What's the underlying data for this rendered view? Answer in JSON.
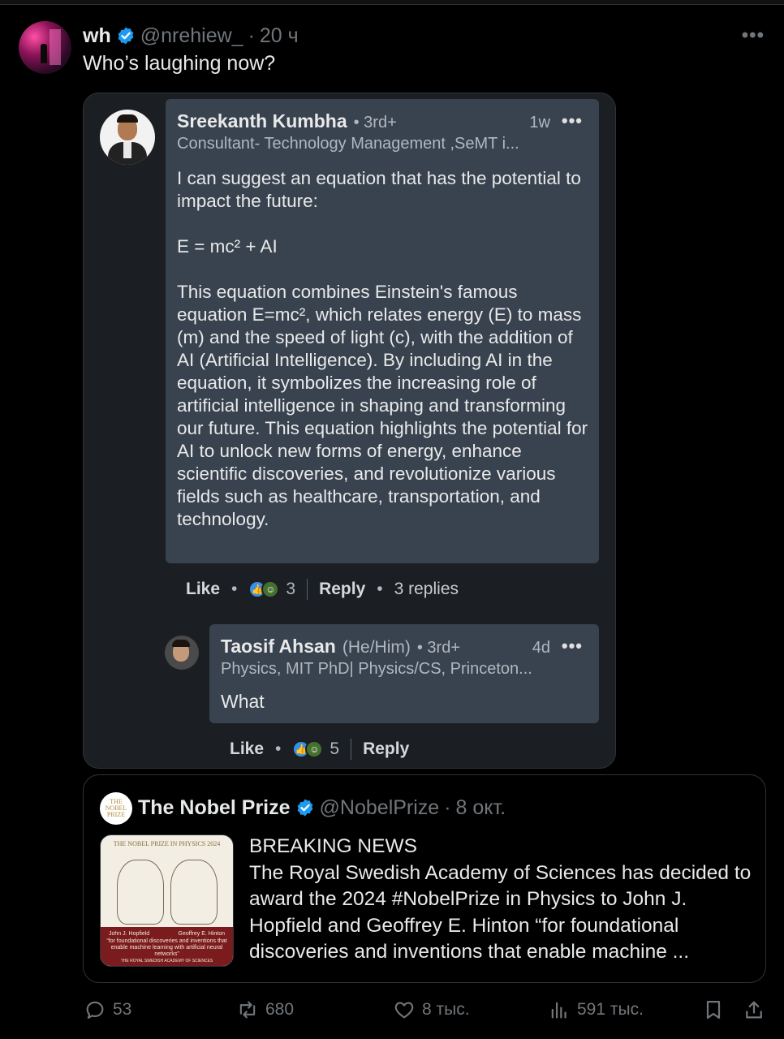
{
  "tweet": {
    "name": "wh",
    "handle": "@nrehiew_",
    "separator": "·",
    "time": "20 ч",
    "text": "Who’s laughing now?",
    "more": "•••"
  },
  "screenshot": {
    "comment1": {
      "name": "Sreekanth Kumbha",
      "degree": "• 3rd+",
      "time": "1w",
      "more": "•••",
      "headline": "Consultant- Technology Management ,SeMT i...",
      "body": "I can suggest an equation that has the potential to impact the future:\n\nE = mc² + AI\n\nThis equation combines Einstein's famous equation E=mc², which relates energy (E) to mass (m) and the speed of light (c), with the addition of AI (Artificial Intelligence). By including AI in the equation, it symbolizes the increasing role of artificial intelligence in shaping and transforming our future. This equation highlights the potential for AI to unlock new forms of energy, enhance scientific discoveries, and revolutionize various fields such as healthcare, transportation, and technology.",
      "like": "Like",
      "reactions": "3",
      "reply": "Reply",
      "replies": "3 replies"
    },
    "comment2": {
      "name": "Taosif Ahsan",
      "pronouns": "(He/Him)",
      "degree": "• 3rd+",
      "time": "4d",
      "more": "•••",
      "headline": "Physics, MIT PhD| Physics/CS, Princeton...",
      "body": "What",
      "like": "Like",
      "reactions": "5",
      "reply": "Reply"
    }
  },
  "quote": {
    "avatar_text": "THE NOBEL PRIZE",
    "name": "The Nobel Prize",
    "handle": "@NobelPrize",
    "separator": "·",
    "time": "8 окт.",
    "image": {
      "title": "THE NOBEL PRIZE IN PHYSICS 2024",
      "laureate1": "John J. Hopfield",
      "laureate2": "Geoffrey E. Hinton",
      "citation": "“for foundational discoveries and inventions that enable machine learning with artificial neural networks”",
      "academy": "THE ROYAL SWEDISH ACADEMY OF SCIENCES"
    },
    "text": "BREAKING NEWS\nThe Royal Swedish Academy of Sciences has decided to award the 2024 #NobelPrize in Physics to John J. Hopfield and Geoffrey E. Hinton “for foundational discoveries and inventions that enable machine ..."
  },
  "actions": {
    "replies": "53",
    "reposts": "680",
    "likes": "8 тыс.",
    "views": "591 тыс."
  },
  "colors": {
    "verified": "#1d9bf0",
    "muted": "#71767b",
    "linkedin_bubble": "#38434f"
  }
}
